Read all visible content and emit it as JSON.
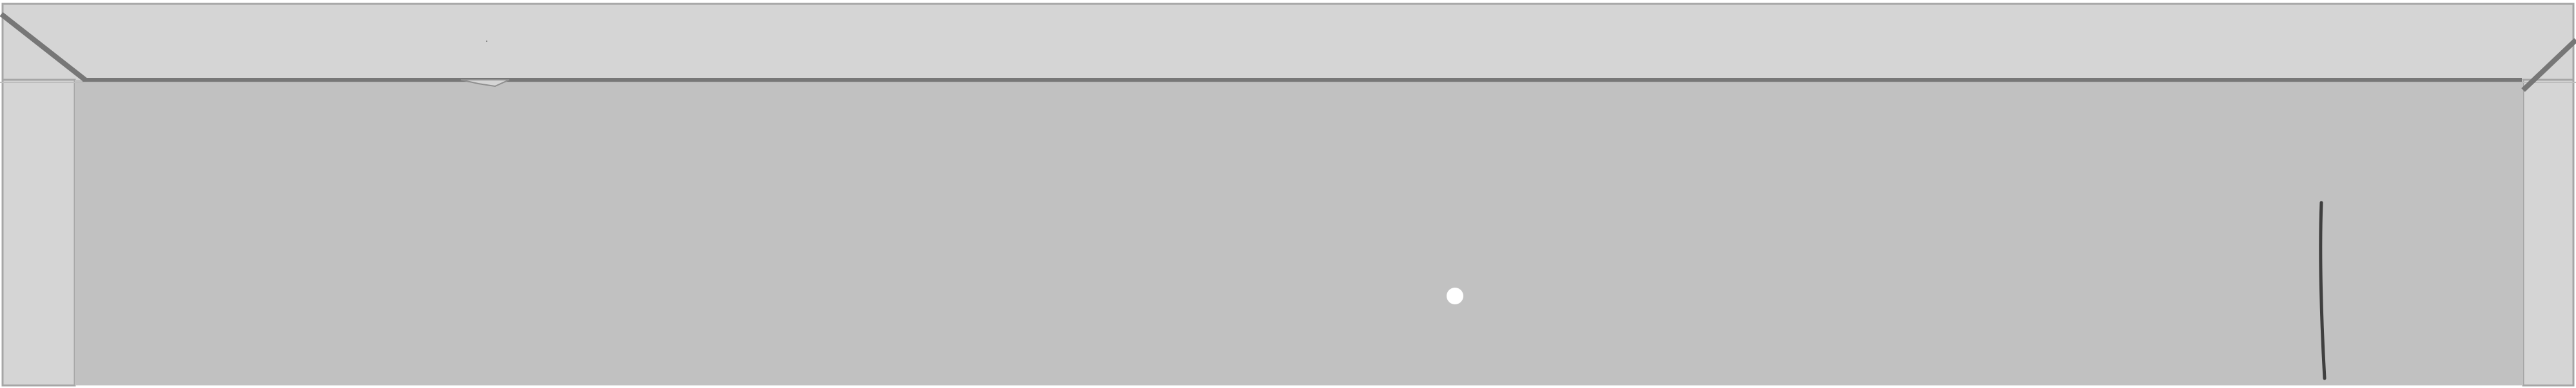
{
  "colors": {
    "frame_fill": "#d5d5d5",
    "inner_fill": "#c1c1c1",
    "edge_line": "#777777",
    "outline": "#a6a6a6",
    "cursor_dot": "#ffffff",
    "stroke_mark": "#3f3f3f"
  },
  "icons": {
    "cursor": "white-dot-cursor-icon",
    "mark": "vertical-stroke-icon"
  }
}
